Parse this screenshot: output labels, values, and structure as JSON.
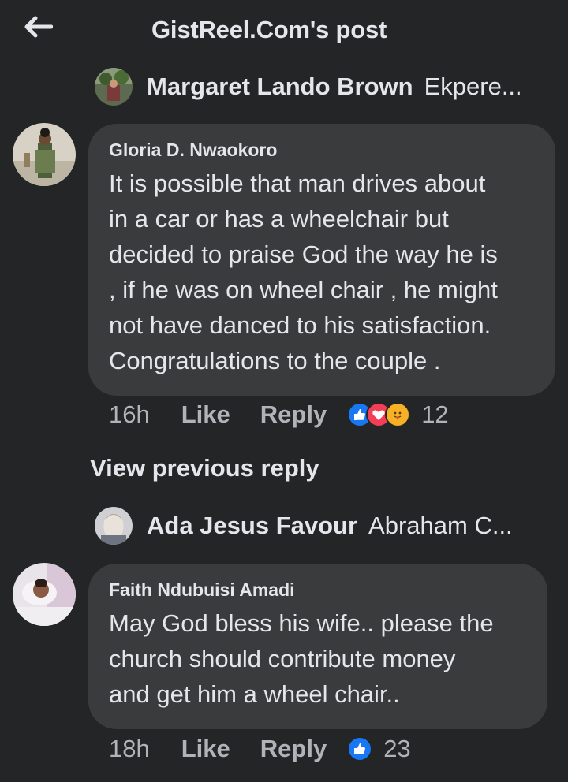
{
  "header": {
    "title": "GistReel.Com's post",
    "back_icon": "arrow-left-icon"
  },
  "reply1": {
    "name": "Margaret Lando Brown",
    "snippet": "Ekpere..."
  },
  "comment1": {
    "author": "Gloria D. Nwaokoro",
    "lines": [
      "It is possible that man drives about",
      "in a car or has a wheelchair but",
      "decided to praise God the way he is",
      ", if he was on wheel chair , he might",
      "not have danced to his satisfaction.",
      "Congratulations to the couple ."
    ],
    "time": "16h",
    "like": "Like",
    "reply": "Reply",
    "reactions": [
      "like",
      "love",
      "care"
    ],
    "reaction_count": "12"
  },
  "view_previous": "View previous reply",
  "reply2": {
    "name": "Ada Jesus Favour",
    "snippet": "Abraham C..."
  },
  "comment2": {
    "author": "Faith Ndubuisi Amadi",
    "lines": [
      "May God bless his wife.. please the",
      "church should contribute money",
      "and get him a wheel chair.."
    ],
    "time": "18h",
    "like": "Like",
    "reply": "Reply",
    "reactions": [
      "like"
    ],
    "reaction_count": "23"
  },
  "colors": {
    "background": "#242526",
    "bubble": "#3a3b3c",
    "text": "#e4e6eb",
    "secondary": "#b0b3b8",
    "like_blue": "#1877f2",
    "love_red": "#f33e58",
    "care_yellow": "#f7b125"
  }
}
